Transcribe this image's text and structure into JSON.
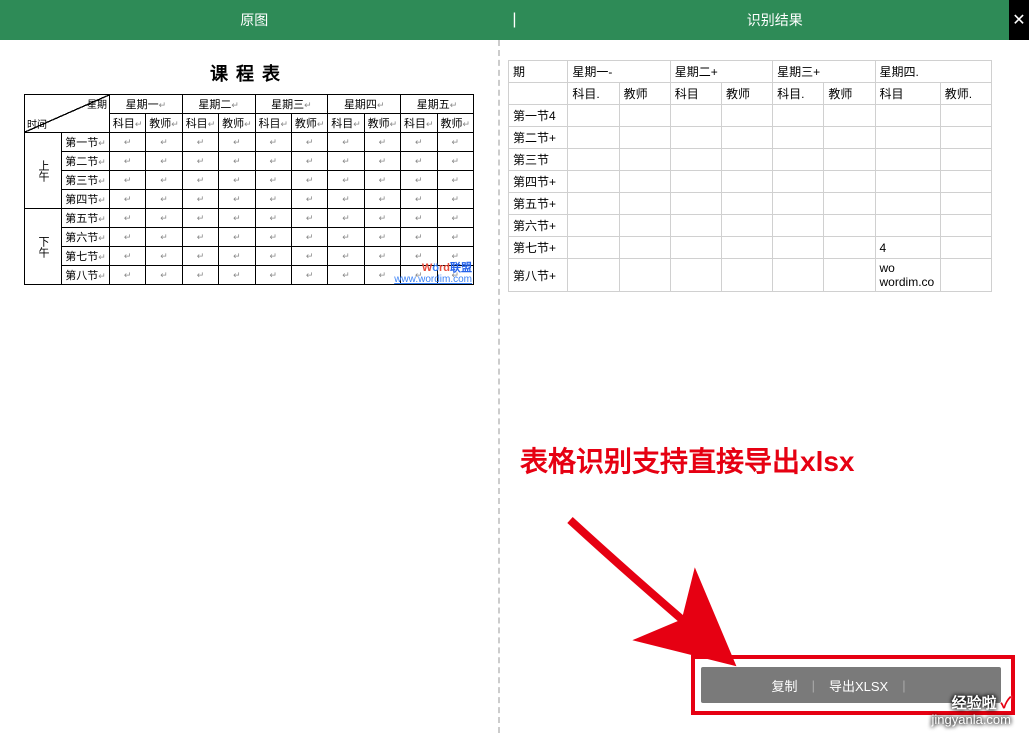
{
  "header": {
    "tab_left": "原图",
    "divider": "|",
    "tab_right": "识别结果",
    "close": "✕"
  },
  "left": {
    "title": "课程表",
    "diag_top": "星期",
    "diag_bottom": "时间",
    "day_headers": [
      "星期一",
      "星期二",
      "星期三",
      "星期四",
      "星期五"
    ],
    "sub_headers": [
      "科目",
      "教师"
    ],
    "time_groups": [
      {
        "label": "上午",
        "rows": [
          "第一节",
          "第二节",
          "第三节",
          "第四节"
        ]
      },
      {
        "label": "下午",
        "rows": [
          "第五节",
          "第六节",
          "第七节",
          "第八节"
        ]
      }
    ],
    "watermark_brand": "Wörd联盟",
    "watermark_url": "www.wordim.com"
  },
  "right": {
    "row0": [
      "期",
      "星期一-",
      "",
      "星期二+",
      "",
      "星期三+",
      "",
      "星期四.",
      ""
    ],
    "row1": [
      "",
      "科目.",
      "教师",
      "科目",
      "教师",
      "科目.",
      "教师",
      "科目",
      "教师."
    ],
    "body_rows": [
      [
        "第一节4",
        "",
        "",
        "",
        "",
        "",
        "",
        "",
        ""
      ],
      [
        "第二节+",
        "",
        "",
        "",
        "",
        "",
        "",
        "",
        ""
      ],
      [
        "第三节",
        "",
        "",
        "",
        "",
        "",
        "",
        "",
        ""
      ],
      [
        "第四节+",
        "",
        "",
        "",
        "",
        "",
        "",
        "",
        ""
      ],
      [
        "第五节+",
        "",
        "",
        "",
        "",
        "",
        "",
        "",
        ""
      ],
      [
        "第六节+",
        "",
        "",
        "",
        "",
        "",
        "",
        "",
        ""
      ],
      [
        "第七节+",
        "",
        "",
        "",
        "",
        "",
        "",
        "4",
        ""
      ],
      [
        "第八节+",
        "",
        "",
        "",
        "",
        "",
        "",
        "wo wordim.co",
        ""
      ]
    ]
  },
  "callout": "表格识别支持直接导出xlsx",
  "actions": {
    "copy": "复制",
    "export": "导出XLSX",
    "sep": "|"
  },
  "site": {
    "name": "经验啦",
    "check": "✓",
    "url": "jingyanla.com"
  }
}
